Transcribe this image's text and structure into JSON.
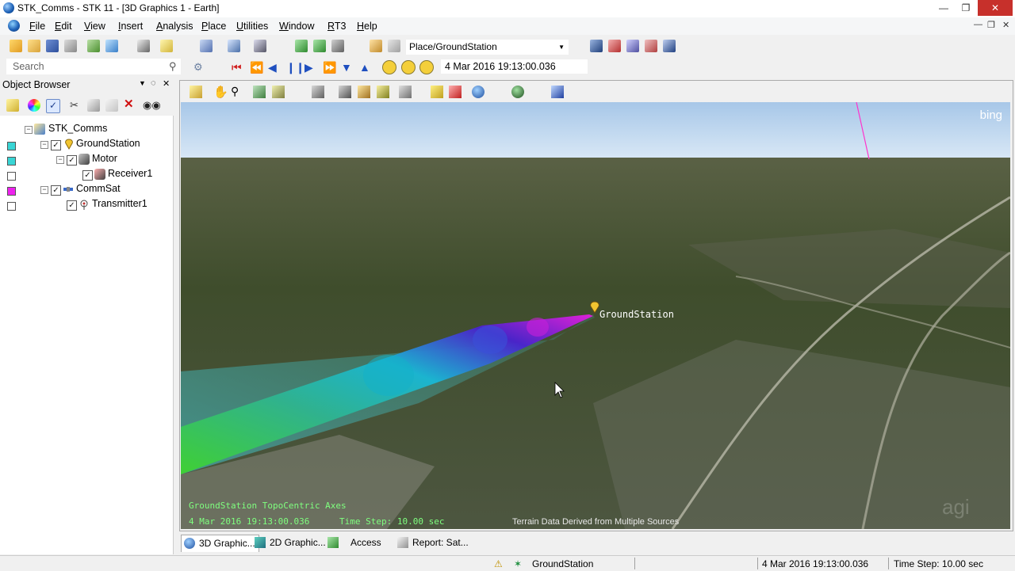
{
  "window": {
    "title": "STK_Comms - STK 11 - [3D Graphics 1 - Earth]"
  },
  "menu": [
    "File",
    "Edit",
    "View",
    "Insert",
    "Analysis",
    "Place",
    "Utilities",
    "Window",
    "RT3",
    "Help"
  ],
  "toolbar": {
    "place_combo": "Place/GroundStation",
    "search_placeholder": "Search",
    "animation_time": "4 Mar 2016 19:13:00.036"
  },
  "object_browser": {
    "title": "Object Browser",
    "tree": [
      {
        "label": "STK_Comms",
        "color": ""
      },
      {
        "label": "GroundStation",
        "color": "#39d5d5"
      },
      {
        "label": "Motor",
        "color": "#39d5d5"
      },
      {
        "label": "Receiver1",
        "color": "#ffffff"
      },
      {
        "label": "CommSat",
        "color": "#ee22ee"
      },
      {
        "label": "Transmitter1",
        "color": "#ffffff"
      }
    ]
  },
  "view3d": {
    "bing_label": "bing",
    "object_label": "GroundStation",
    "axes_label": "GroundStation TopoCentric Axes",
    "time_label": "4 Mar 2016 19:13:00.036",
    "time_step_label": "Time Step: 10.00 sec",
    "terrain_credit": "Terrain Data Derived from Multiple Sources"
  },
  "tabs": [
    {
      "label": "3D Graphic...",
      "active": true
    },
    {
      "label": "2D Graphic...",
      "active": false
    },
    {
      "label": "Access",
      "active": false
    },
    {
      "label": "Report:  Sat...",
      "active": false
    }
  ],
  "status": {
    "current_object": "GroundStation",
    "time": "4 Mar 2016 19:13:00.036",
    "time_step": "Time Step: 10.00 sec"
  },
  "colors": {
    "accent": "#1e62b8",
    "overlay_text": "#7fff7f",
    "link_line": "#ff33cc"
  }
}
